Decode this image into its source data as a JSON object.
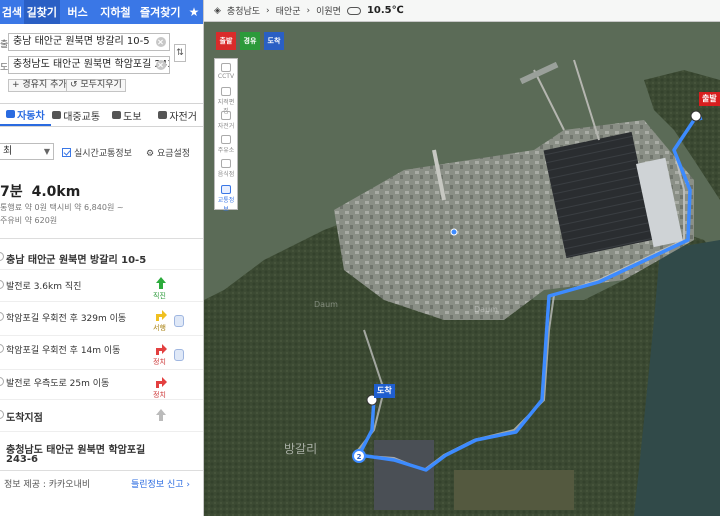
{
  "nav": {
    "tabs": [
      "검색",
      "길찾기",
      "버스",
      "지하철",
      "즐겨찾기",
      "★"
    ],
    "active": 1
  },
  "route": {
    "start_value": "충남 태안군 원북면 방갈리 10-5",
    "end_value": "충청남도 태안군 원북면 학암포길 243-6",
    "start_mark": "출",
    "end_mark": "도",
    "swap": "⇅",
    "add_stop": "+ 경유지 추가",
    "clear_all": "↺ 모두지우기"
  },
  "modes": [
    {
      "label": "자동차",
      "active": true
    },
    {
      "label": "대중교통",
      "active": false
    },
    {
      "label": "도보",
      "active": false
    },
    {
      "label": "자전거",
      "active": false
    }
  ],
  "options": {
    "route_option": "최",
    "realtime_label": "실시간교통정보",
    "realtime_checked": true,
    "fare_label": "요금설정"
  },
  "summary": {
    "time": "7분",
    "distance": "4.0km",
    "line1": "통행료 약 0원  택시비 약 6,840원 ~",
    "line2": "주유비 약 620원"
  },
  "steps": [
    {
      "text": "충남 태안군 원북면 방갈리 10-5",
      "icon_label": ""
    },
    {
      "text": "발전로 3.6km 직진",
      "icon_label": "직진"
    },
    {
      "text": "학암포길 우회전 후 329m 이동",
      "icon_label": "서행"
    },
    {
      "text": "학암포길 우회전 후 14m 이동",
      "icon_label": "정치"
    },
    {
      "text": "발전로 우측도로 25m 이동",
      "icon_label": "정치"
    },
    {
      "text": "도착지점",
      "icon_label": ""
    },
    {
      "text": "충청남도 태안군 원북면 학암포길",
      "icon_label": ""
    },
    {
      "text": "243-6",
      "icon_label": ""
    }
  ],
  "footer": {
    "left": "정보 제공 : 카카오내비",
    "right": "틀린정보 신고 ›"
  },
  "mapbar": {
    "region": "충청남도",
    "county": "태안군",
    "town": "이원면",
    "temperature": "10.5℃"
  },
  "map_controls": {
    "route_buttons": [
      "출발",
      "경유",
      "도착"
    ],
    "tools": [
      "CCTV",
      "지적편집",
      "자전거",
      "주유소",
      "음식점",
      "교통정보"
    ]
  },
  "map_labels": {
    "start_marker": "출발",
    "end_marker": "도착",
    "waypoint": "2",
    "place_name": "방갈리",
    "watermark": "Daum"
  },
  "colors": {
    "brand_blue": "#3a77e6",
    "route_line": "#3d8bff",
    "start_marker": "#d81f1f",
    "end_marker": "#1f5ecf"
  }
}
